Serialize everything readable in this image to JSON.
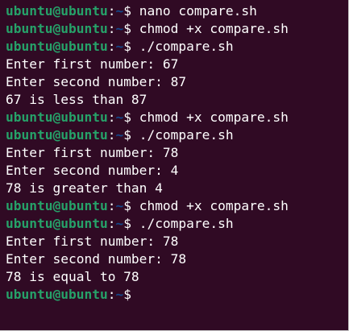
{
  "terminal": {
    "lines": [
      {
        "type": "prompt",
        "user": "ubuntu@ubuntu",
        "sep": ":",
        "path": "~",
        "symbol": "$",
        "command": " nano compare.sh"
      },
      {
        "type": "prompt",
        "user": "ubuntu@ubuntu",
        "sep": ":",
        "path": "~",
        "symbol": "$",
        "command": " chmod +x compare.sh"
      },
      {
        "type": "prompt",
        "user": "ubuntu@ubuntu",
        "sep": ":",
        "path": "~",
        "symbol": "$",
        "command": " ./compare.sh"
      },
      {
        "type": "output",
        "text": "Enter first number: 67"
      },
      {
        "type": "output",
        "text": "Enter second number: 87"
      },
      {
        "type": "output",
        "text": "67 is less than 87"
      },
      {
        "type": "prompt",
        "user": "ubuntu@ubuntu",
        "sep": ":",
        "path": "~",
        "symbol": "$",
        "command": " chmod +x compare.sh"
      },
      {
        "type": "prompt",
        "user": "ubuntu@ubuntu",
        "sep": ":",
        "path": "~",
        "symbol": "$",
        "command": " ./compare.sh"
      },
      {
        "type": "output",
        "text": "Enter first number: 78"
      },
      {
        "type": "output",
        "text": "Enter second number: 4"
      },
      {
        "type": "output",
        "text": "78 is greater than 4"
      },
      {
        "type": "prompt",
        "user": "ubuntu@ubuntu",
        "sep": ":",
        "path": "~",
        "symbol": "$",
        "command": " chmod +x compare.sh"
      },
      {
        "type": "prompt",
        "user": "ubuntu@ubuntu",
        "sep": ":",
        "path": "~",
        "symbol": "$",
        "command": " ./compare.sh"
      },
      {
        "type": "output",
        "text": "Enter first number: 78"
      },
      {
        "type": "output",
        "text": "Enter second number: 78"
      },
      {
        "type": "output",
        "text": "78 is equal to 78"
      },
      {
        "type": "prompt",
        "user": "ubuntu@ubuntu",
        "sep": ":",
        "path": "~",
        "symbol": "$",
        "command": " "
      }
    ]
  },
  "colors": {
    "background": "#300a24",
    "user": "#26a269",
    "path": "#12488b",
    "text": "#ffffff"
  }
}
